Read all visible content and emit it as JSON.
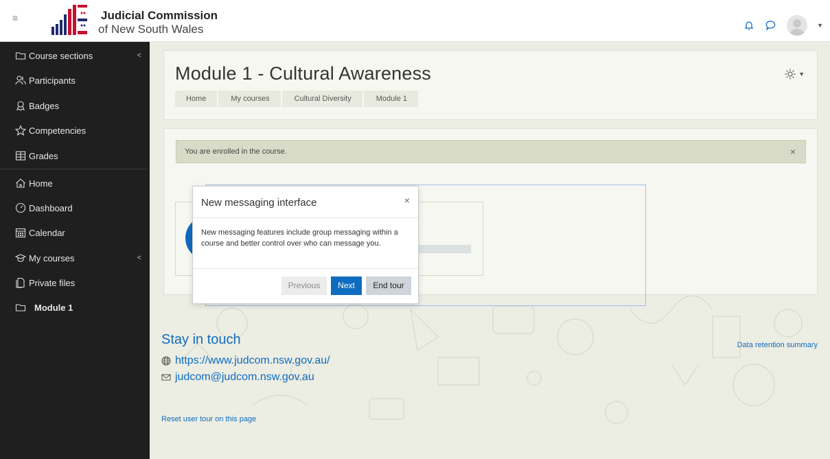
{
  "header": {
    "logo_line1": "Judicial Commission",
    "logo_line2": "of New South Wales",
    "menu_icon": "hamburger-icon",
    "notifications_icon": "bell-icon",
    "messages_icon": "chat-bubble-icon",
    "user_icon": "avatar-icon"
  },
  "sidebar": {
    "items": [
      {
        "label": "Course sections",
        "icon": "folder-icon",
        "has_chevron": true
      },
      {
        "label": "Participants",
        "icon": "users-icon"
      },
      {
        "label": "Badges",
        "icon": "badge-icon"
      },
      {
        "label": "Competencies",
        "icon": "star-icon"
      },
      {
        "label": "Grades",
        "icon": "table-icon"
      },
      {
        "label": "Home",
        "icon": "home-icon"
      },
      {
        "label": "Dashboard",
        "icon": "gauge-icon"
      },
      {
        "label": "Calendar",
        "icon": "calendar-icon"
      },
      {
        "label": "My courses",
        "icon": "graduation-cap-icon",
        "has_chevron": true
      },
      {
        "label": "Private files",
        "icon": "files-icon"
      },
      {
        "label": "Module 1",
        "icon": "folder-icon"
      }
    ],
    "chevron": "<"
  },
  "page": {
    "title": "Module 1 - Cultural Awareness",
    "breadcrumb": [
      "Home",
      "My courses",
      "Cultural Diversity",
      "Module 1"
    ],
    "alert": "You are enrolled in the course.",
    "alert_close": "×"
  },
  "modal": {
    "title": "New messaging interface",
    "close": "×",
    "body": "New messaging features include group messaging within a course and better control over who can message you.",
    "buttons": {
      "previous": "Previous",
      "next": "Next",
      "end": "End tour"
    }
  },
  "footer": {
    "title": "Stay in touch",
    "website": "https://www.judcom.nsw.gov.au/",
    "email": "judcom@judcom.nsw.gov.au",
    "data_retention": "Data retention summary",
    "reset_tour": "Reset user tour on this page"
  },
  "colors": {
    "accent": "#0f6cbf",
    "sidebar_bg": "#1f1f1f",
    "main_bg": "#ecede3",
    "alert_bg": "#d8dbc7"
  }
}
